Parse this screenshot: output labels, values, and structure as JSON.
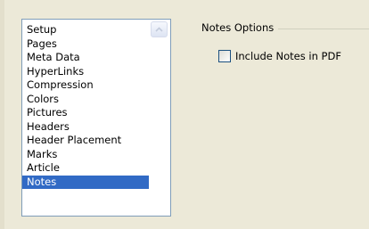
{
  "sections": {
    "items": [
      {
        "label": "Setup"
      },
      {
        "label": "Pages"
      },
      {
        "label": "Meta Data"
      },
      {
        "label": "HyperLinks"
      },
      {
        "label": "Compression"
      },
      {
        "label": "Colors"
      },
      {
        "label": "Pictures"
      },
      {
        "label": "Headers"
      },
      {
        "label": "Header Placement"
      },
      {
        "label": "Marks"
      },
      {
        "label": "Article"
      },
      {
        "label": "Notes"
      }
    ],
    "selected": "Notes"
  },
  "notes_options": {
    "title": "Notes Options",
    "include_notes_label": "Include Notes in PDF",
    "include_notes_checked": false
  },
  "colors": {
    "selection": "#316ac5",
    "background": "#ece9d8"
  },
  "icons": {
    "scroll_up": "chevron-up-icon"
  }
}
